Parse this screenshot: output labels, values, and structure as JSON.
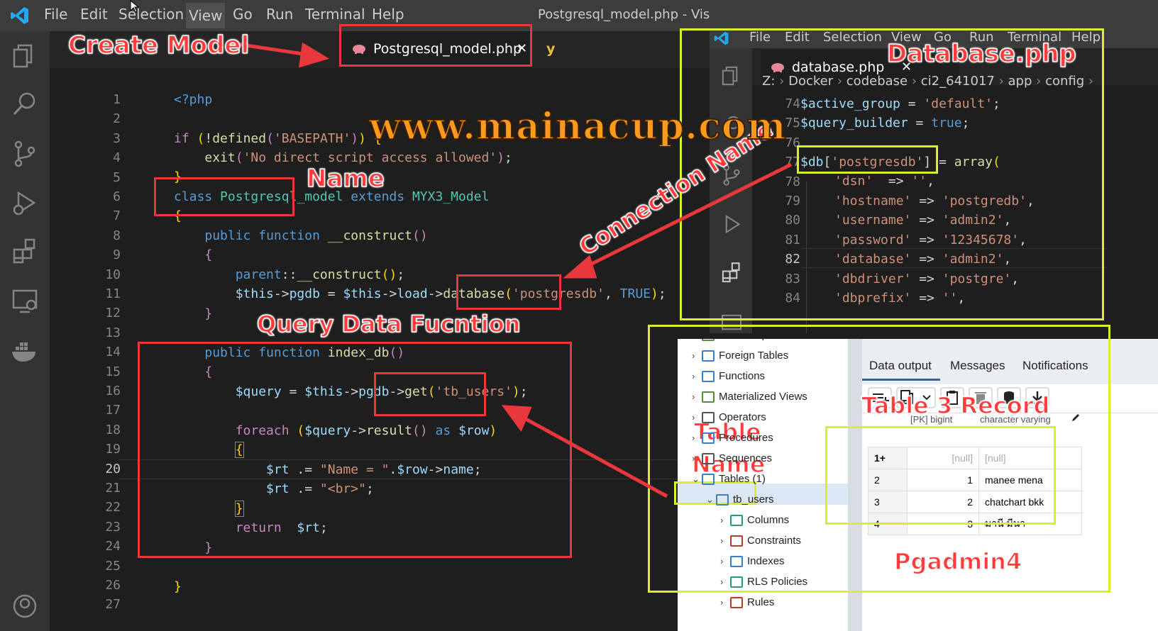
{
  "main_menu": {
    "items": [
      "File",
      "Edit",
      "Selection",
      "View",
      "Go",
      "Run",
      "Terminal",
      "Help"
    ],
    "window_title": "Postgresql_model.php - Vis"
  },
  "main_tab": {
    "label": "Postgresql_model.php",
    "close": "✕",
    "next_tab_icon": "y"
  },
  "main_code": {
    "line_numbers": [
      "1",
      "2",
      "3",
      "4",
      "5",
      "6",
      "7",
      "8",
      "9",
      "10",
      "11",
      "12",
      "13",
      "14",
      "15",
      "16",
      "17",
      "18",
      "19",
      "20",
      "21",
      "22",
      "23",
      "24",
      "25",
      "26",
      "27"
    ],
    "current_line": "20"
  },
  "inset_menu": {
    "items": [
      "File",
      "Edit",
      "Selection",
      "View",
      "Go",
      "Run",
      "Terminal",
      "Help"
    ]
  },
  "inset_tab": {
    "label": "database.php",
    "close": "✕"
  },
  "inset_breadcrumb": [
    "Z:",
    "Docker",
    "codebase",
    "ci2_641017",
    "app",
    "config"
  ],
  "inset_code": {
    "line_numbers": [
      "74",
      "75",
      "76",
      "77",
      "78",
      "79",
      "80",
      "81",
      "82",
      "83",
      "84"
    ],
    "current_line": "82"
  },
  "pgadmin": {
    "tree": [
      {
        "label": "FTS Templates",
        "icon": "fts-templates-icon"
      },
      {
        "label": "Foreign Tables",
        "icon": "foreign-tables-icon"
      },
      {
        "label": "Functions",
        "icon": "functions-icon"
      },
      {
        "label": "Materialized Views",
        "icon": "materialized-views-icon"
      },
      {
        "label": "Operators",
        "icon": "operators-icon"
      },
      {
        "label": "Procedures",
        "icon": "procedures-icon"
      },
      {
        "label": "Sequences",
        "icon": "sequences-icon"
      },
      {
        "label": "Tables (1)",
        "icon": "tables-icon"
      },
      {
        "label": "tb_users",
        "icon": "table-icon"
      },
      {
        "label": "Columns",
        "icon": "columns-icon"
      },
      {
        "label": "Constraints",
        "icon": "constraints-icon"
      },
      {
        "label": "Indexes",
        "icon": "indexes-icon"
      },
      {
        "label": "RLS Policies",
        "icon": "rls-policies-icon"
      },
      {
        "label": "Rules",
        "icon": "rules-icon"
      }
    ],
    "tabs": [
      "Data output",
      "Messages",
      "Notifications"
    ],
    "columns": [
      "[PK] bigint",
      "character varying"
    ],
    "rows": [
      {
        "row": "1+",
        "id": "[null]",
        "name": "[null]"
      },
      {
        "row": "2",
        "id": "1",
        "name": "manee mena"
      },
      {
        "row": "3",
        "id": "2",
        "name": "chatchart bkk"
      },
      {
        "row": "4",
        "id": "3",
        "name": "มานี มีนา"
      }
    ]
  },
  "annotations": {
    "create_model": "Create Model",
    "name": "Name",
    "database_php": "Database.php",
    "connection_name": "Connection Name",
    "query_data_function": "Query Data Fucntion",
    "table_3_record": "Table 3 Record",
    "table_name_1": "Table",
    "table_name_2": "Name",
    "pgadmin4": "Pgadmin4",
    "watermark": "www.mainacup.com"
  }
}
